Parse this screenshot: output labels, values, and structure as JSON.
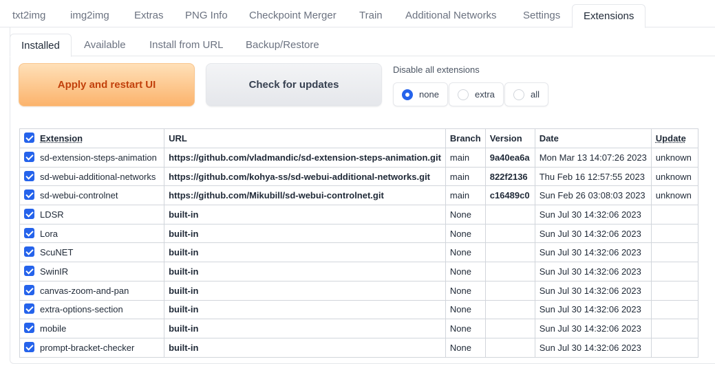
{
  "main_tabs": [
    "txt2img",
    "img2img",
    "Extras",
    "PNG Info",
    "Checkpoint Merger",
    "Train",
    "Additional Networks",
    "Settings",
    "Extensions"
  ],
  "sub_tabs": [
    "Installed",
    "Available",
    "Install from URL",
    "Backup/Restore"
  ],
  "buttons": {
    "apply": "Apply and restart UI",
    "check": "Check for updates"
  },
  "disable_all": {
    "label": "Disable all extensions",
    "options": [
      "none",
      "extra",
      "all"
    ],
    "selected": "none"
  },
  "table": {
    "headers": [
      "Extension",
      "URL",
      "Branch",
      "Version",
      "Date",
      "Update"
    ],
    "rows": [
      {
        "name": "sd-extension-steps-animation",
        "url": "https://github.com/vladmandic/sd-extension-steps-animation.git",
        "branch": "main",
        "version": "9a40ea6a",
        "date": "Mon Mar 13 14:07:26 2023",
        "update": "unknown"
      },
      {
        "name": "sd-webui-additional-networks",
        "url": "https://github.com/kohya-ss/sd-webui-additional-networks.git",
        "branch": "main",
        "version": "822f2136",
        "date": "Thu Feb 16 12:57:55 2023",
        "update": "unknown"
      },
      {
        "name": "sd-webui-controlnet",
        "url": "https://github.com/Mikubill/sd-webui-controlnet.git",
        "branch": "main",
        "version": "c16489c0",
        "date": "Sun Feb 26 03:08:03 2023",
        "update": "unknown"
      },
      {
        "name": "LDSR",
        "url": "built-in",
        "branch": "None",
        "version": "",
        "date": "Sun Jul 30 14:32:06 2023",
        "update": ""
      },
      {
        "name": "Lora",
        "url": "built-in",
        "branch": "None",
        "version": "",
        "date": "Sun Jul 30 14:32:06 2023",
        "update": ""
      },
      {
        "name": "ScuNET",
        "url": "built-in",
        "branch": "None",
        "version": "",
        "date": "Sun Jul 30 14:32:06 2023",
        "update": ""
      },
      {
        "name": "SwinIR",
        "url": "built-in",
        "branch": "None",
        "version": "",
        "date": "Sun Jul 30 14:32:06 2023",
        "update": ""
      },
      {
        "name": "canvas-zoom-and-pan",
        "url": "built-in",
        "branch": "None",
        "version": "",
        "date": "Sun Jul 30 14:32:06 2023",
        "update": ""
      },
      {
        "name": "extra-options-section",
        "url": "built-in",
        "branch": "None",
        "version": "",
        "date": "Sun Jul 30 14:32:06 2023",
        "update": ""
      },
      {
        "name": "mobile",
        "url": "built-in",
        "branch": "None",
        "version": "",
        "date": "Sun Jul 30 14:32:06 2023",
        "update": ""
      },
      {
        "name": "prompt-bracket-checker",
        "url": "built-in",
        "branch": "None",
        "version": "",
        "date": "Sun Jul 30 14:32:06 2023",
        "update": ""
      }
    ]
  },
  "colors": {
    "accent": "#2563eb",
    "primary_button_text": "#c2410c"
  }
}
